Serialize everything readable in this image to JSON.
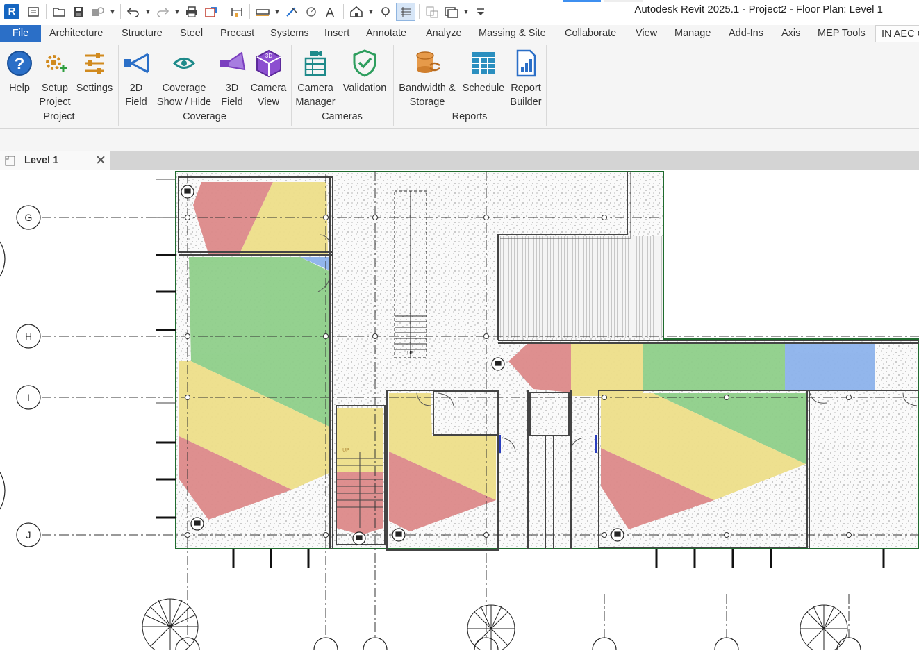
{
  "app": {
    "window_title": "Autodesk Revit 2025.1 - Project2 - Floor Plan: Level 1",
    "logo_letter": "R"
  },
  "quick_access": [
    "open-icon",
    "save-icon",
    "sync-icon",
    "undo-icon",
    "redo-icon",
    "print-icon",
    "export-icon",
    "measure-icon",
    "dimension-icon",
    "tag-icon",
    "text-icon",
    "3d-view-icon",
    "section-icon",
    "thin-lines-icon",
    "close-hidden-icon",
    "switch-windows-icon",
    "customize-icon"
  ],
  "ribbon_tabs": [
    "File",
    "Architecture",
    "Structure",
    "Steel",
    "Precast",
    "Systems",
    "Insert",
    "Annotate",
    "Analyze",
    "Massing & Site",
    "Collaborate",
    "View",
    "Manage",
    "Add-Ins",
    "Axis",
    "MEP Tools",
    "IN AEC C"
  ],
  "ribbon": {
    "panels": [
      {
        "title": "Project",
        "buttons": [
          {
            "line1": "Help",
            "line2": "",
            "icon": "help-icon"
          },
          {
            "line1": "Setup",
            "line2": "Project",
            "icon": "setup-icon"
          },
          {
            "line1": "Settings",
            "line2": "",
            "icon": "settings-icon"
          }
        ]
      },
      {
        "title": "Coverage",
        "buttons": [
          {
            "line1": "2D",
            "line2": "Field",
            "icon": "2d-field-icon"
          },
          {
            "line1": "Coverage",
            "line2": "Show / Hide",
            "icon": "eye-icon"
          },
          {
            "line1": "3D",
            "line2": "Field",
            "icon": "3d-field-icon"
          },
          {
            "line1": "Camera",
            "line2": "View",
            "icon": "camera-view-icon"
          }
        ]
      },
      {
        "title": "Cameras",
        "buttons": [
          {
            "line1": "Camera",
            "line2": "Manager",
            "icon": "camera-manager-icon"
          },
          {
            "line1": "Validation",
            "line2": "",
            "icon": "shield-check-icon"
          }
        ]
      },
      {
        "title": "Reports",
        "buttons": [
          {
            "line1": "Bandwidth &",
            "line2": "Storage",
            "icon": "storage-icon"
          },
          {
            "line1": "Schedule",
            "line2": "",
            "icon": "schedule-icon"
          },
          {
            "line1": "Report",
            "line2": "Builder",
            "icon": "report-icon"
          }
        ]
      }
    ]
  },
  "view_tab": {
    "label": "Level 1",
    "close": "✕"
  },
  "grid_labels": [
    "G",
    "H",
    "I",
    "J"
  ],
  "stair_labels": {
    "up1": "UP",
    "up2": "UP"
  },
  "colors": {
    "coverage_red": "#dd8a8a",
    "coverage_yellow": "#eedf8a",
    "coverage_green": "#8fcf8a",
    "coverage_blue": "#8db3ec",
    "accent": "#2b6fc7"
  }
}
